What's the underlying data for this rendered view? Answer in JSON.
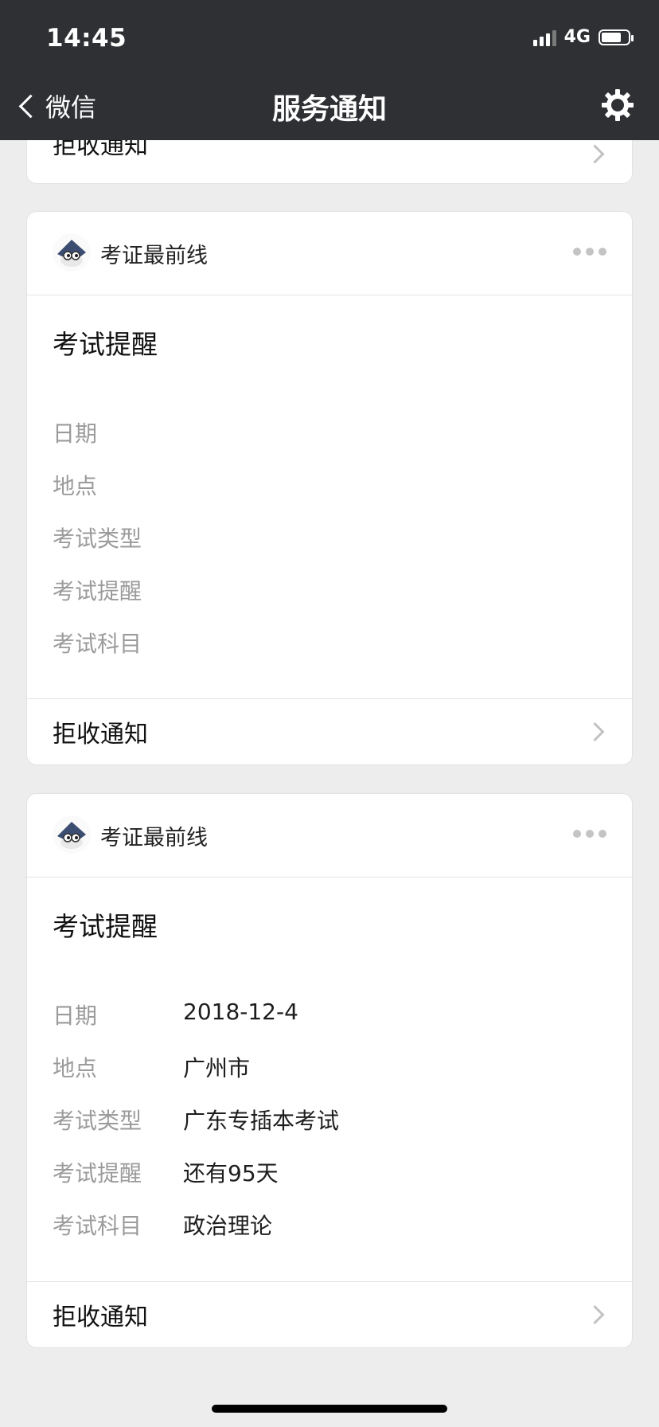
{
  "status_bar": {
    "time": "14:45",
    "network": "4G"
  },
  "nav": {
    "back_label": "微信",
    "title": "服务通知"
  },
  "cards": [
    {
      "reject_label": "拒收通知"
    },
    {
      "source": "考证最前线",
      "title": "考试提醒",
      "fields": [
        {
          "label": "日期",
          "value": ""
        },
        {
          "label": "地点",
          "value": ""
        },
        {
          "label": "考试类型",
          "value": ""
        },
        {
          "label": "考试提醒",
          "value": ""
        },
        {
          "label": "考试科目",
          "value": ""
        }
      ],
      "reject_label": "拒收通知"
    },
    {
      "source": "考证最前线",
      "title": "考试提醒",
      "fields": [
        {
          "label": "日期",
          "value": "2018-12-4"
        },
        {
          "label": "地点",
          "value": "广州市"
        },
        {
          "label": "考试类型",
          "value": "广东专插本考试"
        },
        {
          "label": "考试提醒",
          "value": "还有95天"
        },
        {
          "label": "考试科目",
          "value": "政治理论"
        }
      ],
      "reject_label": "拒收通知"
    }
  ],
  "colors": {
    "header_bg": "#2f3034",
    "page_bg": "#ededed",
    "label_gray": "#9b9b9b"
  },
  "icons": [
    "back-chevron-icon",
    "settings-gear-icon",
    "more-dots-icon",
    "chevron-right-icon",
    "signal-icon",
    "battery-icon"
  ]
}
